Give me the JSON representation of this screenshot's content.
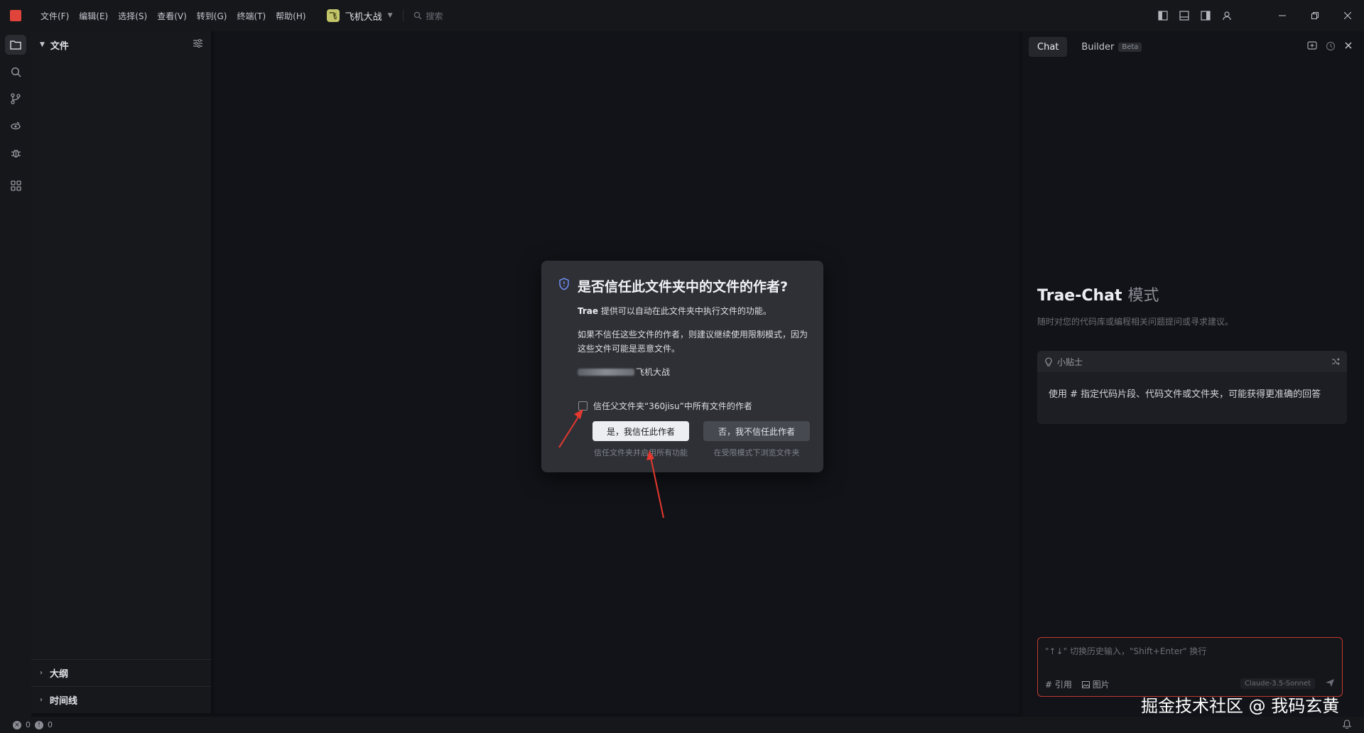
{
  "menu": {
    "items": [
      "文件(F)",
      "编辑(E)",
      "选择(S)",
      "查看(V)",
      "转到(G)",
      "终端(T)",
      "帮助(H)"
    ]
  },
  "project": {
    "icon_letter": "飞",
    "name": "飞机大战"
  },
  "search": {
    "placeholder": "搜索"
  },
  "sidebar": {
    "title": "文件",
    "sections": [
      "大纲",
      "时间线"
    ]
  },
  "chat": {
    "tabs": [
      "Chat",
      "Builder"
    ],
    "beta_label": "Beta",
    "title": "Trae-Chat",
    "title_mode": "模式",
    "subtitle": "随时对您的代码库或编程相关问题提问或寻求建议。",
    "tip_label": "小贴士",
    "tip_body": "使用 # 指定代码片段、代码文件或文件夹，可能获得更准确的回答",
    "input_placeholder": "\"↑↓\" 切换历史输入，\"Shift+Enter\" 换行",
    "action_ref": "# 引用",
    "action_image": "图片",
    "model": "Claude-3.5-Sonnet"
  },
  "dialog": {
    "title": "是否信任此文件夹中的文件的作者?",
    "p1_brand": "Trae",
    "p1_rest": " 提供可以自动在此文件夹中执行文件的功能。",
    "p2": "如果不信任这些文件的作者，则建议继续使用限制模式，因为这些文件可能是恶意文件。",
    "path_suffix": "飞机大战",
    "checkbox_label": "信任父文件夹“360jisu”中所有文件的作者",
    "yes_button": "是，我信任此作者",
    "no_button": "否，我不信任此作者",
    "yes_hint": "信任文件夹并启用所有功能",
    "no_hint": "在受限模式下浏览文件夹"
  },
  "status": {
    "errors": "0",
    "warnings": "0"
  },
  "watermark": "掘金技术社区 @ 我码玄黄",
  "colors": {
    "accent_red": "#e0443a",
    "input_border": "#c03a30",
    "arrow": "#e5382e"
  }
}
